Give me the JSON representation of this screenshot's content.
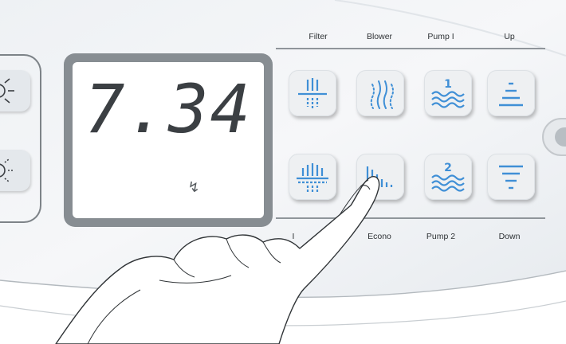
{
  "display": {
    "reading": "7.34",
    "indicator": "↯"
  },
  "labels": {
    "filter": "Filter",
    "blower": "Blower",
    "pump1": "Pump I",
    "up": "Up",
    "light_partial": "I",
    "econo": "Econo",
    "pump2": "Pump 2",
    "down": "Down"
  },
  "keys": {
    "filter": {
      "icon": "filter-icon"
    },
    "blower": {
      "icon": "blower-icon"
    },
    "pump1": {
      "icon": "pump-1-icon",
      "number": "1"
    },
    "up": {
      "icon": "up-icon"
    },
    "light": {
      "icon": "filter-heavy-icon"
    },
    "econo": {
      "icon": "econo-icon"
    },
    "pump2": {
      "icon": "pump-2-icon",
      "number": "2"
    },
    "down": {
      "icon": "down-icon"
    }
  },
  "colors": {
    "accent_blue": "#3f8fd6",
    "frame_gray": "#878d92",
    "key_face": "#eef0f2"
  }
}
